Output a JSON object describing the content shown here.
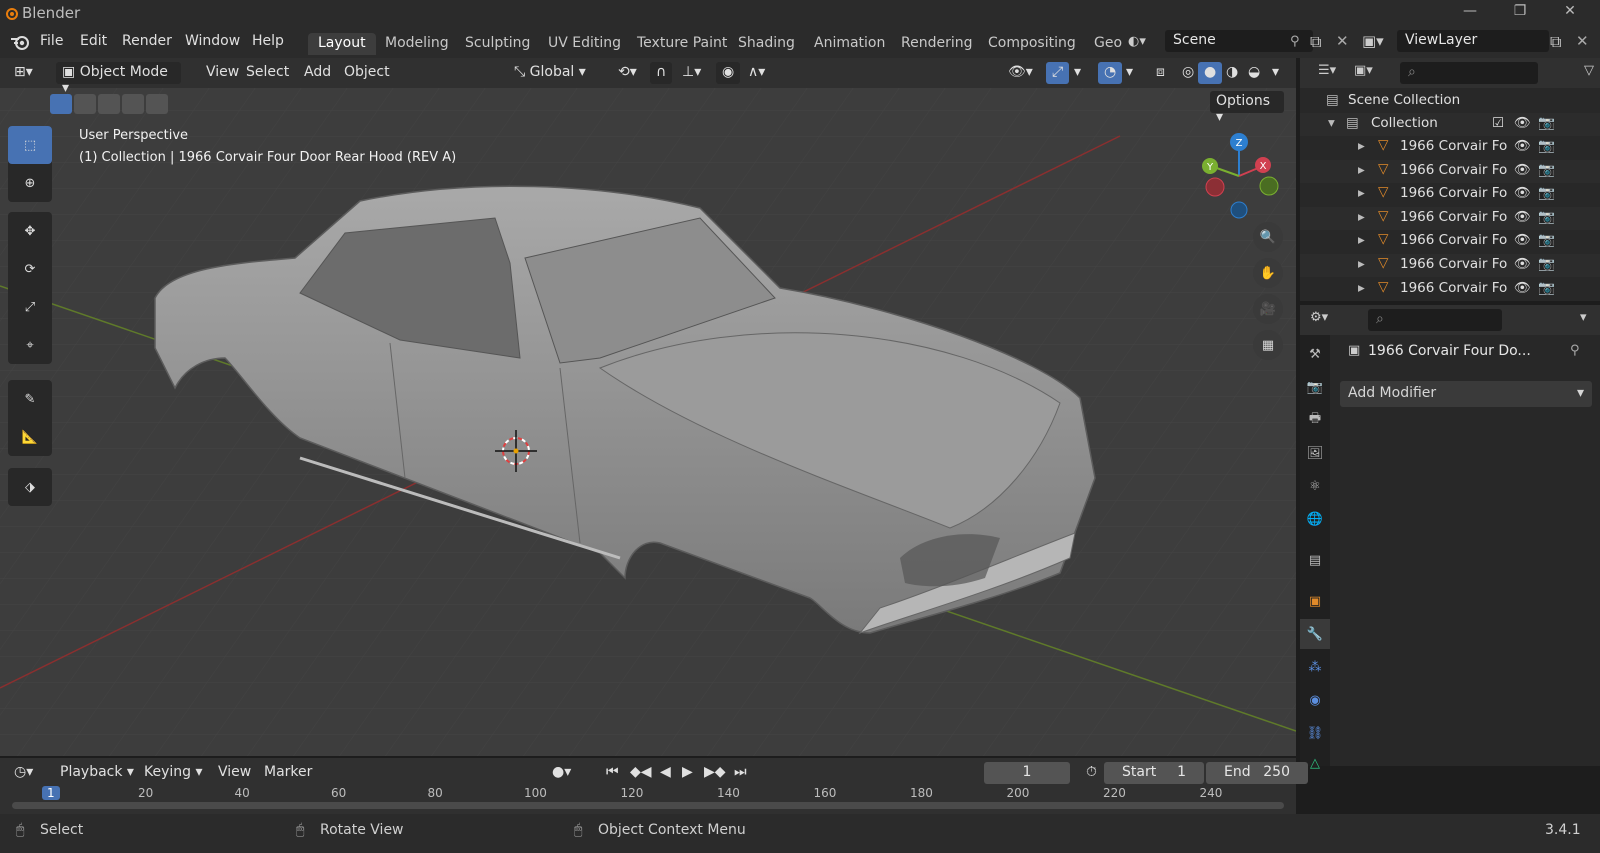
{
  "window": {
    "title": "Blender",
    "min": "—",
    "max": "❐",
    "close": "✕"
  },
  "menubar": {
    "menus": [
      "File",
      "Edit",
      "Render",
      "Window",
      "Help"
    ],
    "tabs": [
      "Layout",
      "Modeling",
      "Sculpting",
      "UV Editing",
      "Texture Paint",
      "Shading",
      "Animation",
      "Rendering",
      "Compositing",
      "Geo"
    ],
    "scene": "Scene",
    "view_layer": "ViewLayer"
  },
  "viewport": {
    "mode": "Object Mode",
    "menus": [
      "View",
      "Select",
      "Add",
      "Object"
    ],
    "transform_orientation": "Global",
    "options": "Options",
    "perspective": "User Perspective",
    "collection_info": "(1) Collection | 1966 Corvair Four Door Rear Hood (REV A)",
    "gizmo": {
      "z": "Z",
      "y": "Y",
      "x": "X"
    }
  },
  "outliner": {
    "root": "Scene Collection",
    "collection": "Collection",
    "items": [
      "1966 Corvair Fo",
      "1966 Corvair Fo",
      "1966 Corvair Fo",
      "1966 Corvair Fo",
      "1966 Corvair Fo",
      "1966 Corvair Fo",
      "1966 Corvair Fo"
    ]
  },
  "properties": {
    "object_name": "1966 Corvair Four Do...",
    "add_modifier": "Add Modifier"
  },
  "timeline": {
    "menus": [
      "Playback",
      "Keying",
      "View",
      "Marker"
    ],
    "current_frame": "1",
    "start_label": "Start",
    "start": "1",
    "end_label": "End",
    "end": "250",
    "ticks": [
      "1",
      "20",
      "40",
      "60",
      "80",
      "100",
      "120",
      "140",
      "160",
      "180",
      "200",
      "220",
      "240"
    ]
  },
  "statusbar": {
    "select": "Select",
    "rotate": "Rotate View",
    "context": "Object Context Menu",
    "version": "3.4.1"
  },
  "colors": {
    "accent": "#4772b3",
    "viewport_bg": "#3d3d3d",
    "panel_bg": "#282828"
  }
}
